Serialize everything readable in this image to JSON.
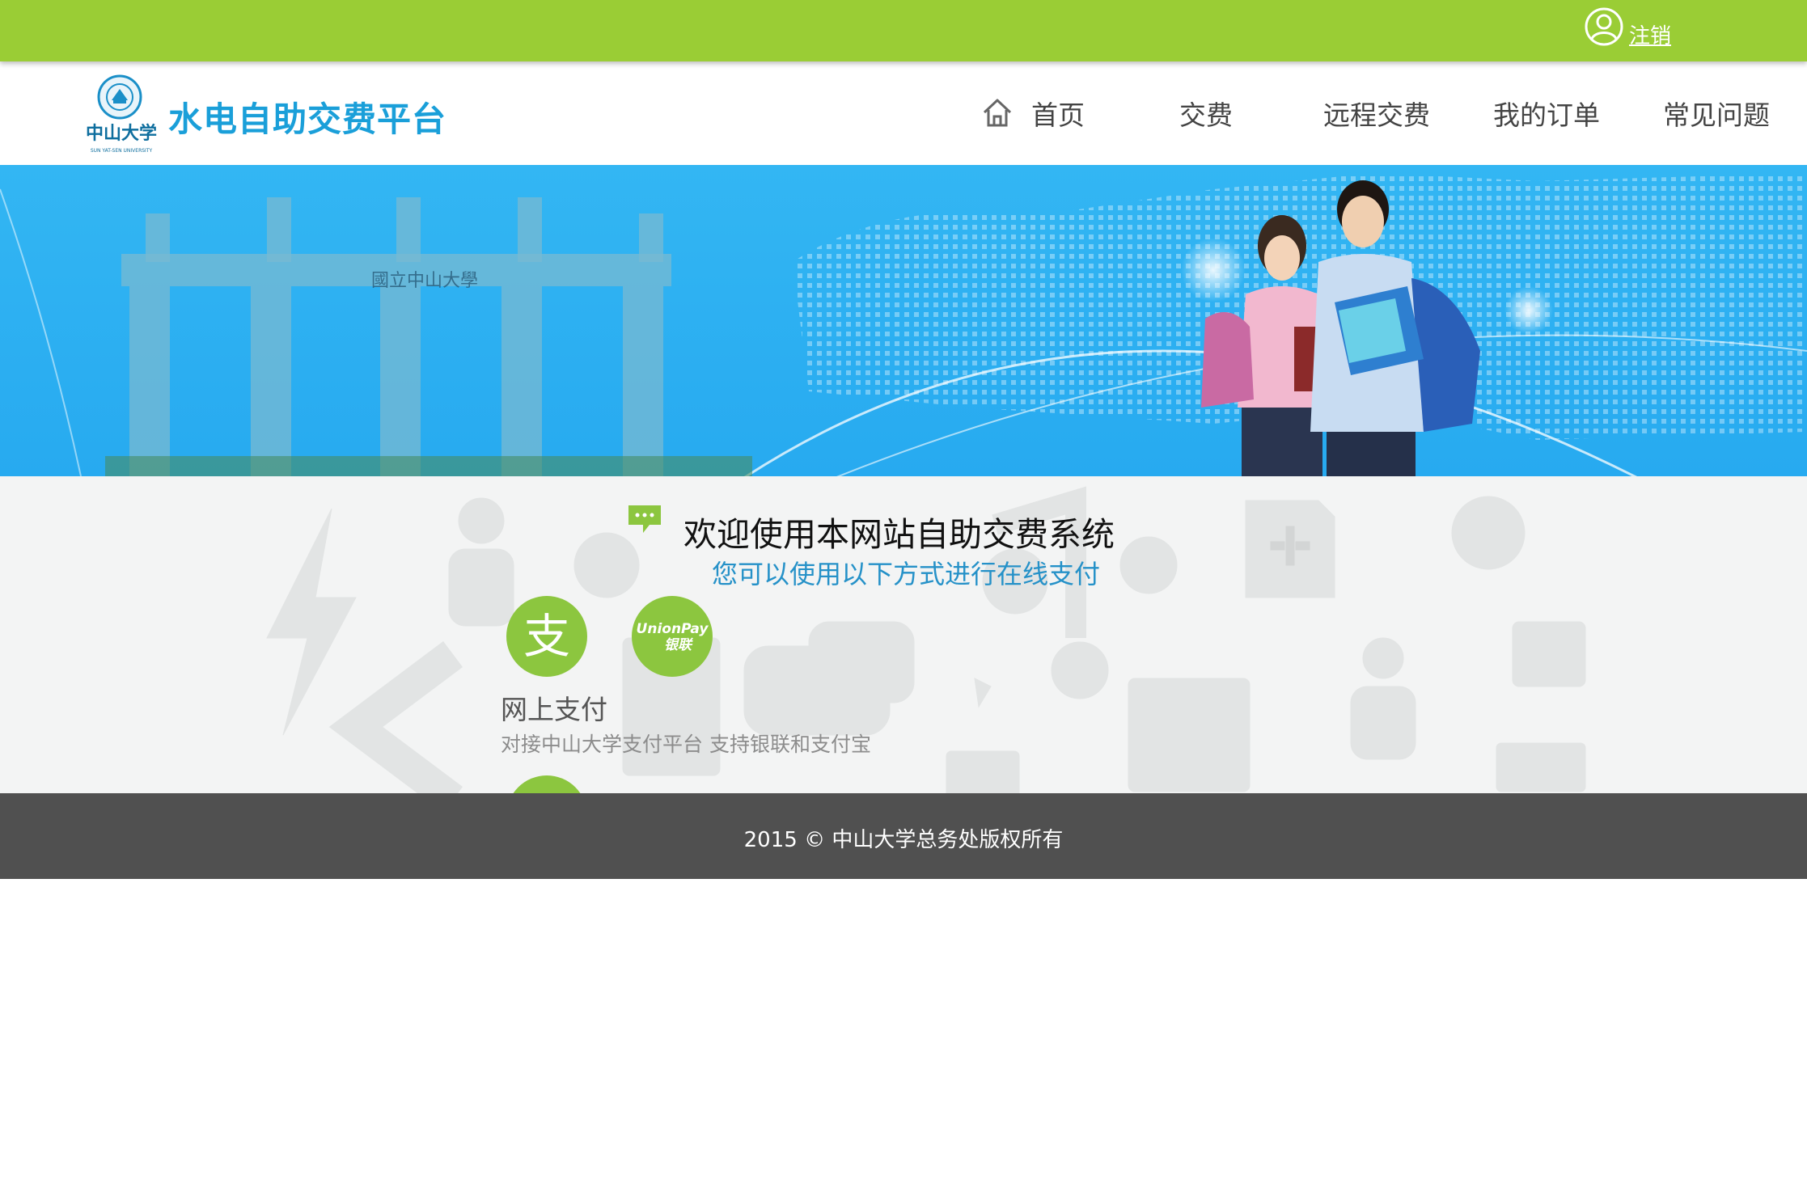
{
  "topbar": {
    "logout_label": "注销"
  },
  "header": {
    "title": "水电自助交费平台",
    "logo_text": "中山大学",
    "logo_subtext": "SUN YAT-SEN UNIVERSITY"
  },
  "nav": {
    "home": "首页",
    "pay": "交费",
    "remote_pay": "远程交费",
    "orders": "我的订单",
    "faq": "常见问题"
  },
  "banner": {
    "gate_text": "國立中山大學"
  },
  "main": {
    "welcome": "欢迎使用本网站自助交费系统",
    "subtitle": "您可以使用以下方式进行在线支付",
    "alipay_glyph": "支",
    "unionpay_en": "UnionPay",
    "unionpay_cn": "银联",
    "payment_title": "网上支付",
    "payment_desc": "对接中山大学支付平台 支持银联和支付宝"
  },
  "footer": {
    "copyright": "2015 © 中山大学总务处版权所有"
  },
  "colors": {
    "green": "#9acd35",
    "blue_title": "#1a9fd9",
    "banner_blue": "#29abf1",
    "footer_gray": "#505050"
  }
}
